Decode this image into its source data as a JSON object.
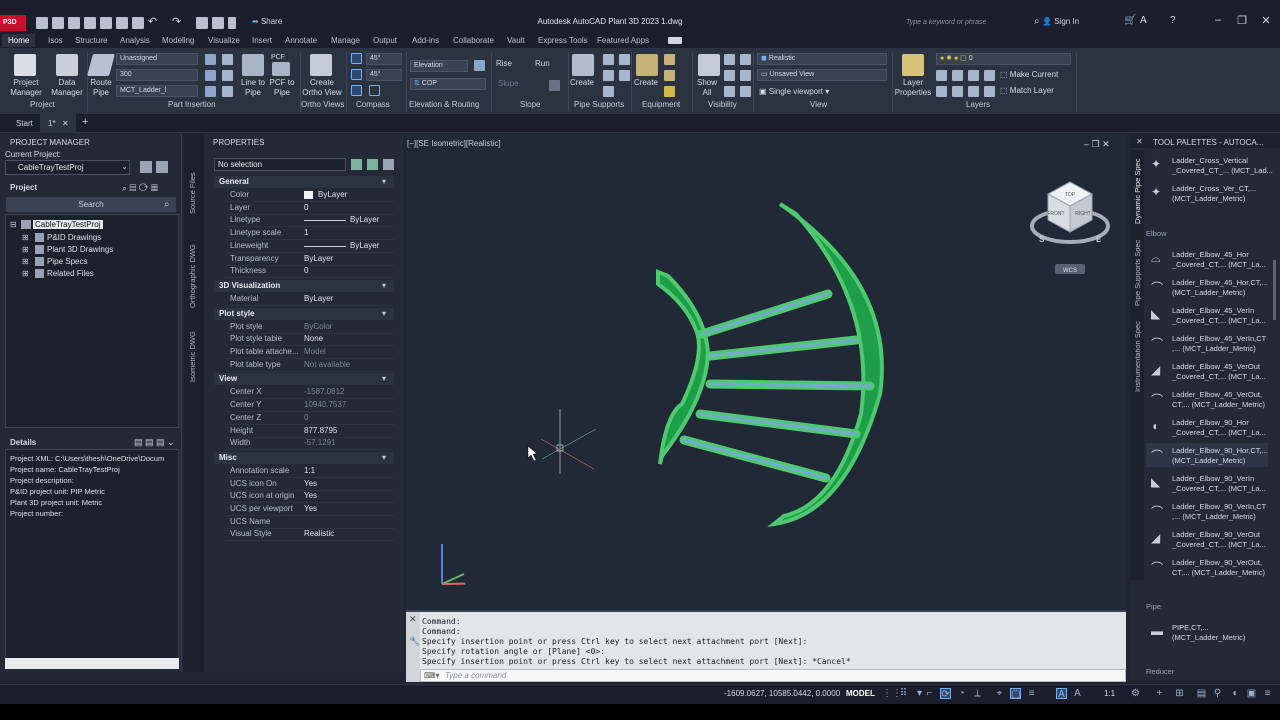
{
  "app": {
    "badge": "P3D",
    "window_title": "Autodesk AutoCAD Plant 3D 2023   1.dwg",
    "share": "Share",
    "search_placeholder": "Type a keyword or phrase",
    "sign_in": "Sign In"
  },
  "ribbon": {
    "tabs": [
      "Home",
      "Isos",
      "Structure",
      "Analysis",
      "Modeling",
      "Visualize",
      "Insert",
      "Annotate",
      "Manage",
      "Output",
      "Add-ins",
      "Collaborate",
      "Vault",
      "Express Tools",
      "Featured Apps"
    ],
    "panels": {
      "project": "Project",
      "part_insertion": "Part Insertion",
      "ortho_views": "Ortho Views",
      "compass": "Compass",
      "elevation_routing": "Elevation & Routing",
      "slope": "Slope",
      "pipe_supports": "Pipe Supports",
      "equipment": "Equipment",
      "visibility": "Visibility",
      "view": "View",
      "layers": "Layers"
    },
    "buttons": {
      "project_manager": "Project\nManager",
      "data_manager": "Data\nManager",
      "route_pipe": "Route\nPipe",
      "line_to_pipe": "Line to\nPipe",
      "pcf_to_pipe": "PCF to\nPipe",
      "pcf_top": "PCF",
      "create_ortho_view": "Create\nOrtho View",
      "create_support": "Create",
      "create_equipment": "Create",
      "show_all": "Show\nAll",
      "layer_properties": "Layer\nProperties",
      "make_current": "Make Current",
      "match_layer": "Match Layer",
      "elevation": "Elevation",
      "rise": "Rise",
      "run": "Run",
      "slope": "Slope"
    },
    "combos": {
      "spec": "Unassigned",
      "size": "300",
      "part": "MCT_Ladder_l",
      "angle1": "45°",
      "angle2": "45°",
      "cop": "COP",
      "visual_style": "Realistic",
      "saved_view": "Unsaved View",
      "viewport": "Single viewport",
      "layer": "0"
    }
  },
  "doctabs": {
    "start": "Start",
    "drawing": "1*"
  },
  "project_manager": {
    "title": "PROJECT MANAGER",
    "current_project_label": "Current Project:",
    "current_project": "CableTrayTestProj",
    "project_label": "Project",
    "search": "Search",
    "tree": [
      "CableTrayTestProj",
      "P&ID Drawings",
      "Plant 3D Drawings",
      "Pipe Specs",
      "Related Files"
    ],
    "details_title": "Details",
    "details": [
      "Project XML:  C:\\Users\\thesh\\OneDrive\\Docum",
      "Project name:  CableTrayTestProj",
      "Project description:",
      "P&ID project unit: PIP Metric",
      "Plant 3D project unit: Metric",
      "Project number:"
    ]
  },
  "side_tabs": [
    "Source Files",
    "Orthographic DWG",
    "Isometric DWG"
  ],
  "properties": {
    "title": "PROPERTIES",
    "selection": "No selection",
    "sections": [
      {
        "name": "General",
        "rows": [
          {
            "label": "Color",
            "value": "ByLayer"
          },
          {
            "label": "Layer",
            "value": "0"
          },
          {
            "label": "Linetype",
            "value": "ByLayer"
          },
          {
            "label": "Linetype scale",
            "value": "1"
          },
          {
            "label": "Lineweight",
            "value": "ByLayer"
          },
          {
            "label": "Transparency",
            "value": "ByLayer"
          },
          {
            "label": "Thickness",
            "value": "0"
          }
        ]
      },
      {
        "name": "3D Visualization",
        "rows": [
          {
            "label": "Material",
            "value": "ByLayer"
          }
        ]
      },
      {
        "name": "Plot style",
        "rows": [
          {
            "label": "Plot style",
            "value": "ByColor"
          },
          {
            "label": "Plot style table",
            "value": "None"
          },
          {
            "label": "Plot table attache...",
            "value": "Model"
          },
          {
            "label": "Plot table type",
            "value": "Not available"
          }
        ]
      },
      {
        "name": "View",
        "rows": [
          {
            "label": "Center X",
            "value": "-1587.0812"
          },
          {
            "label": "Center Y",
            "value": "10940.7537"
          },
          {
            "label": "Center Z",
            "value": "0"
          },
          {
            "label": "Height",
            "value": "877.8795"
          },
          {
            "label": "Width",
            "value": "-57.1291"
          }
        ]
      },
      {
        "name": "Misc",
        "rows": [
          {
            "label": "Annotation scale",
            "value": "1:1"
          },
          {
            "label": "UCS icon On",
            "value": "Yes"
          },
          {
            "label": "UCS icon at origin",
            "value": "Yes"
          },
          {
            "label": "UCS per viewport",
            "value": "Yes"
          },
          {
            "label": "UCS Name",
            "value": ""
          },
          {
            "label": "Visual Style",
            "value": "Realistic"
          }
        ]
      }
    ]
  },
  "viewport": {
    "label": "[−][SE Isometric][Realistic]",
    "viewcube": {
      "top": "TOP",
      "front": "FRONT",
      "right": "RIGHT",
      "wcs": "WCS",
      "compass_s": "S",
      "compass_e": "E"
    }
  },
  "command": {
    "history": [
      "Command:",
      "Command:",
      "Specify insertion point or press Ctrl key to select next attachment port [Next]:",
      "Specify rotation angle or [Plane] <0>:",
      "Specify insertion point or press Ctrl key to select next attachment port [Next]: *Cancel*"
    ],
    "placeholder": "Type a command"
  },
  "tool_palette": {
    "title": "TOOL PALETTES - AUTOCA...",
    "side_tabs": [
      "Dynamic Pipe Spec",
      "Pipe Supports Spec",
      "Instrumentation Spec"
    ],
    "top_items": [
      "Ladder_Cross_Vertical\n_Covered_CT_... (MCT_Lad...",
      "Ladder_Cross_Ver_CT,...\n(MCT_Ladder_Metric)"
    ],
    "elbow_label": "Elbow",
    "elbow_items": [
      "Ladder_Elbow_45_Hor\n_Covered_CT,... (MCT_La...",
      "Ladder_Elbow_45_Hor,CT,...\n(MCT_Ladder_Metric)",
      "Ladder_Elbow_45_VerIn\n_Covered_CT,... (MCT_La...",
      "Ladder_Elbow_45_VerIn,CT\n,... (MCT_Ladder_Metric)",
      "Ladder_Elbow_45_VerOut\n_Covered_CT,... (MCT_La...",
      "Ladder_Elbow_45_VerOut,\nCT,... (MCT_Ladder_Metric)",
      "Ladder_Elbow_90_Hor\n_Covered_CT,... (MCT_La...",
      "Ladder_Elbow_90_Hor,CT,...\n(MCT_Ladder_Metric)",
      "Ladder_Elbow_90_VerIn\n_Covered_CT,... (MCT_La...",
      "Ladder_Elbow_90_VerIn,CT\n,... (MCT_Ladder_Metric)",
      "Ladder_Elbow_90_VerOut\n_Covered_CT,... (MCT_La...",
      "Ladder_Elbow_90_VerOut,\nCT,... (MCT_Ladder_Metric)"
    ],
    "pipe_label": "Pipe",
    "pipe_item": "PIPE,CT,...\n(MCT_Ladder_Metric)",
    "reducer_label": "Reducer"
  },
  "statusbar": {
    "coords": "-1609.0627, 10585.0442, 0.0000",
    "model": "MODEL",
    "scale": "1:1"
  },
  "colors": {
    "tray_green": "#1e9e48",
    "tray_edge": "#4ec96f",
    "rung_blue": "#78a8d8"
  }
}
